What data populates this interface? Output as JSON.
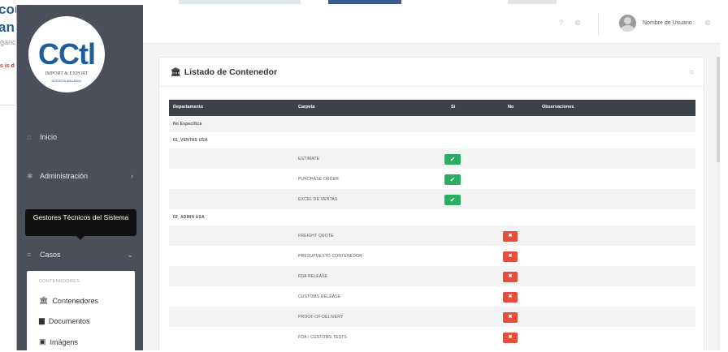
{
  "background": {
    "left_text_1": "cou",
    "left_text_2": "an",
    "left_text_3": "ganci",
    "left_text_4": "s is d"
  },
  "sidebar": {
    "logo_text": "CCtl",
    "logo_sub1": "IMPORT & EXPORT",
    "logo_sub2": "AGENCIA ADUANAL",
    "items": [
      {
        "label": "Inicio",
        "icon": "home-icon"
      },
      {
        "label": "Administración",
        "icon": "gears-icon"
      },
      {
        "label": "Casos",
        "icon": "list-icon"
      }
    ],
    "tooltip": "Gestores Técnicos del Sistema",
    "submenu": {
      "header": "CONTENEDORES",
      "items": [
        {
          "label": "Contenedores",
          "icon": "bank-icon"
        },
        {
          "label": "Documentos",
          "icon": "file-icon"
        },
        {
          "label": "Imágens",
          "icon": "image-icon"
        }
      ]
    }
  },
  "topbar": {
    "username": "Nombre de Usuario"
  },
  "card": {
    "title": "Listado de Contenedor",
    "table": {
      "headers": [
        "Departamento",
        "Carpeta",
        "Sí",
        "No",
        "Observaciones"
      ],
      "rows": [
        {
          "type": "group",
          "department": "No Especifica",
          "shade": true
        },
        {
          "type": "group",
          "department": "01_VENTAS USA",
          "shade": false
        },
        {
          "type": "item",
          "folder": "ESTIMATE",
          "status": "si",
          "shade": true
        },
        {
          "type": "item",
          "folder": "PURCHASE ORDER",
          "status": "si",
          "shade": false
        },
        {
          "type": "item",
          "folder": "EXCEL DE VENTAS",
          "status": "si",
          "shade": true
        },
        {
          "type": "group",
          "department": "02_ADMIN USA",
          "shade": false
        },
        {
          "type": "item",
          "folder": "FREIGHT QUOTE",
          "status": "no",
          "shade": true
        },
        {
          "type": "item",
          "folder": "PRESUPUESTO CONTENEDOR",
          "status": "no",
          "shade": false
        },
        {
          "type": "item",
          "folder": "FDA RELEASE",
          "status": "no",
          "shade": true
        },
        {
          "type": "item",
          "folder": "CUSTOMS RELEASE",
          "status": "no",
          "shade": false
        },
        {
          "type": "item",
          "folder": "PROOF OF DELIVERY",
          "status": "no",
          "shade": true
        },
        {
          "type": "item",
          "folder": "FDA / CUSTOMS TESTS",
          "status": "no",
          "shade": false
        }
      ]
    }
  },
  "colors": {
    "sidebar": "#4b4f5c",
    "table_header": "#3d4149",
    "badge_si": "#27ae60",
    "badge_no": "#e74c3c",
    "logo": "#1f5e9a"
  }
}
